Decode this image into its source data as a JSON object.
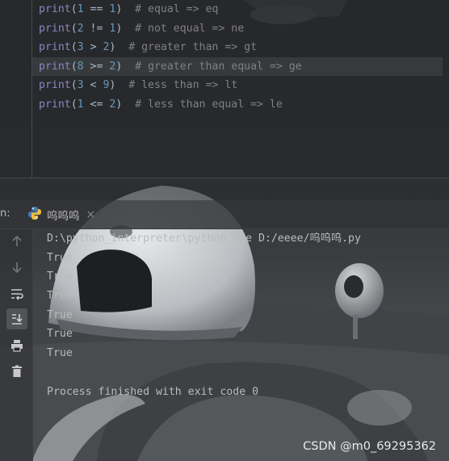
{
  "editor": {
    "lines": [
      {
        "fn": "print",
        "open": "(",
        "a": "1",
        "op": " == ",
        "b": "1",
        "close": ")",
        "comment": "  # equal => eq"
      },
      {
        "fn": "print",
        "open": "(",
        "a": "2",
        "op": " != ",
        "b": "1",
        "close": ")",
        "comment": "  # not equal => ne"
      },
      {
        "fn": "print",
        "open": "(",
        "a": "3",
        "op": " > ",
        "b": "2",
        "close": ")",
        "comment": "  # greater than => gt"
      },
      {
        "fn": "print",
        "open": "(",
        "a": "8",
        "op": " >= ",
        "b": "2",
        "close": ")",
        "comment": "  # greater than equal => ge"
      },
      {
        "fn": "print",
        "open": "(",
        "a": "3",
        "op": " < ",
        "b": "9",
        "close": ")",
        "comment": "  # less than => lt"
      },
      {
        "fn": "print",
        "open": "(",
        "a": "1",
        "op": " <= ",
        "b": "2",
        "close": ")",
        "comment": "  # less than equal => le"
      }
    ]
  },
  "run_window": {
    "label": "n:",
    "tab_name": "呜呜呜",
    "tab_close": "×"
  },
  "toolbar": {
    "icons": [
      "rerun-up-icon",
      "stop-down-icon",
      "soft-wrap-icon",
      "scroll-to-end-icon",
      "print-icon",
      "trash-icon"
    ]
  },
  "console": {
    "command": "D:\\python_interpreter\\python.exe D:/eeee/呜呜呜.py",
    "output": [
      "True",
      "True",
      "True",
      "True",
      "True",
      "True"
    ],
    "blank": "",
    "exit_message": "Process finished with exit code 0"
  },
  "watermark": "CSDN @m0_69295362",
  "colors": {
    "function": "#8888c6",
    "number": "#6897bb",
    "comment": "#808080",
    "text": "#bbbbbb",
    "background": "#2b2b2b"
  }
}
